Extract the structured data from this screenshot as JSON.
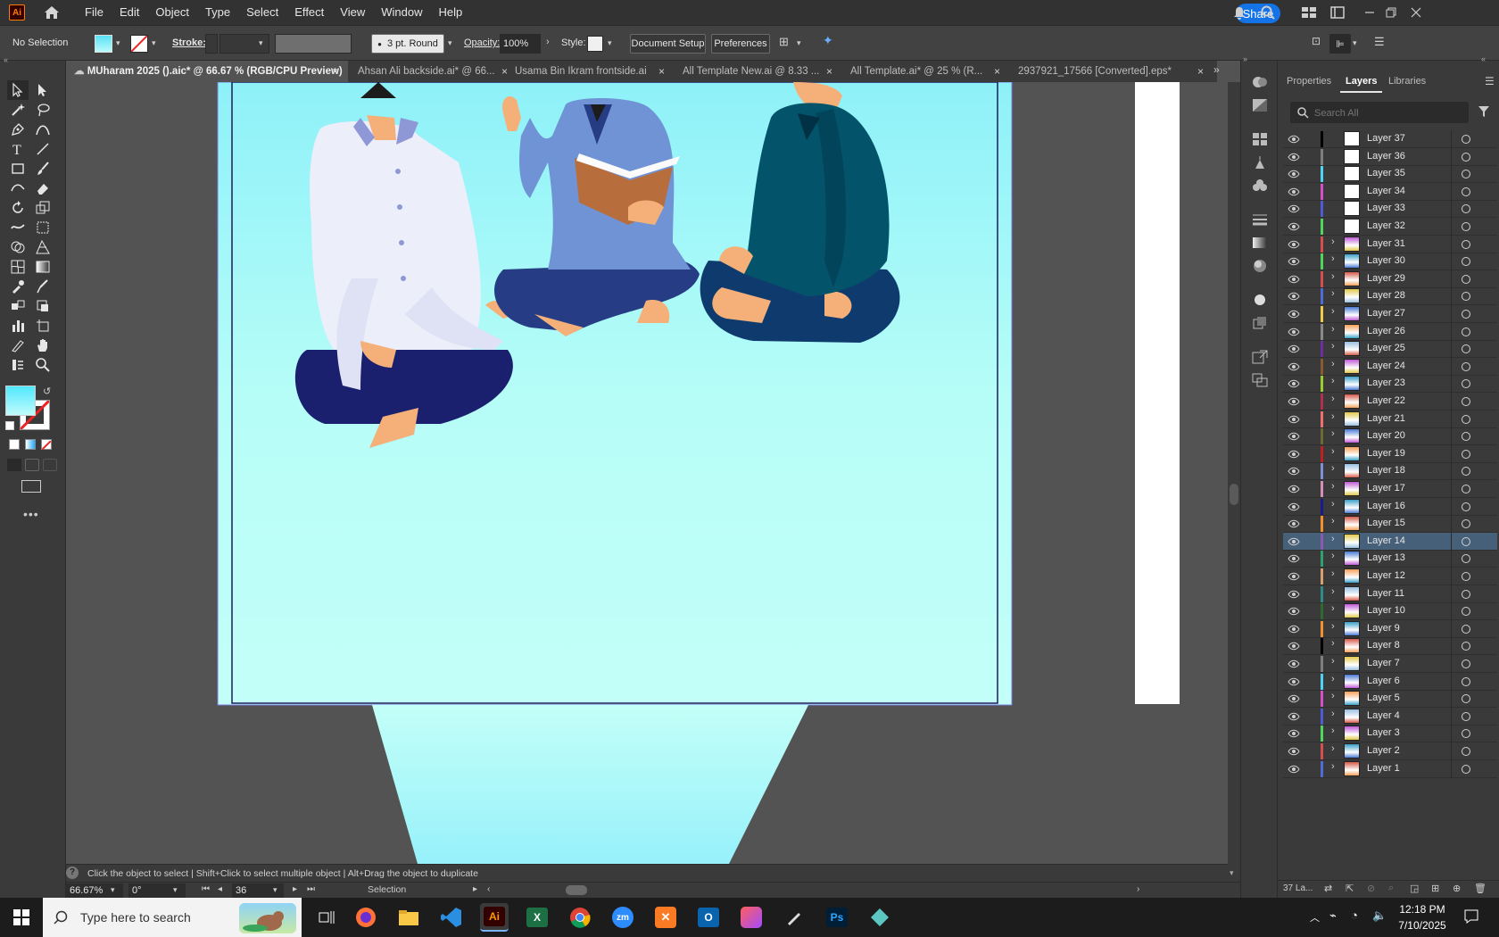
{
  "app": {
    "logo": "Ai",
    "menu": [
      "File",
      "Edit",
      "Object",
      "Type",
      "Select",
      "Effect",
      "View",
      "Window",
      "Help"
    ],
    "share_label": "Share"
  },
  "control": {
    "selection": "No Selection",
    "stroke_label": "Stroke:",
    "brush": "3 pt. Round",
    "opacity_label": "Opacity:",
    "opacity_value": "100%",
    "style_label": "Style:",
    "document_setup": "Document Setup",
    "preferences": "Preferences"
  },
  "tabs": [
    {
      "label": "MUharam 2025 ().aic* @ 66.67 % (RGB/CPU Preview)",
      "active": true
    },
    {
      "label": "Ahsan Ali backside.ai* @ 66...",
      "active": false
    },
    {
      "label": "Usama Bin Ikram frontside.ai",
      "active": false
    },
    {
      "label": "All Template New.ai @ 8.33 ...",
      "active": false
    },
    {
      "label": "All Template.ai* @ 25 % (R...",
      "active": false
    },
    {
      "label": "2937921_17566 [Converted].eps*",
      "active": false
    }
  ],
  "panel": {
    "tabs": [
      "Properties",
      "Layers",
      "Libraries"
    ],
    "search_placeholder": "Search All",
    "layers": [
      {
        "name": "Layer 37",
        "color": "#000000",
        "expand": false,
        "thumb": "white"
      },
      {
        "name": "Layer 36",
        "color": "#7f7f7f",
        "expand": false,
        "thumb": "white"
      },
      {
        "name": "Layer 35",
        "color": "#4fd3f5",
        "expand": false,
        "thumb": "white"
      },
      {
        "name": "Layer 34",
        "color": "#d64fc8",
        "expand": false,
        "thumb": "white"
      },
      {
        "name": "Layer 33",
        "color": "#4f5bd5",
        "expand": false,
        "thumb": "white"
      },
      {
        "name": "Layer 32",
        "color": "#4fd65b",
        "expand": false,
        "thumb": "white"
      },
      {
        "name": "Layer 31",
        "color": "#d64f4f",
        "expand": true,
        "thumb": "img"
      },
      {
        "name": "Layer 30",
        "color": "#4fd65b",
        "expand": true,
        "thumb": "img"
      },
      {
        "name": "Layer 29",
        "color": "#d64f4f",
        "expand": true,
        "thumb": "img"
      },
      {
        "name": "Layer 28",
        "color": "#4f6bd5",
        "expand": true,
        "thumb": "img"
      },
      {
        "name": "Layer 27",
        "color": "#f2c94f",
        "expand": true,
        "thumb": "img"
      },
      {
        "name": "Layer 26",
        "color": "#8a8a8a",
        "expand": true,
        "thumb": "img"
      },
      {
        "name": "Layer 25",
        "color": "#6b2fa0",
        "expand": true,
        "thumb": "img"
      },
      {
        "name": "Layer 24",
        "color": "#8a5a2f",
        "expand": true,
        "thumb": "img"
      },
      {
        "name": "Layer 23",
        "color": "#9acd32",
        "expand": true,
        "thumb": "img"
      },
      {
        "name": "Layer 22",
        "color": "#b03050",
        "expand": true,
        "thumb": "img"
      },
      {
        "name": "Layer 21",
        "color": "#f07070",
        "expand": true,
        "thumb": "img"
      },
      {
        "name": "Layer 20",
        "color": "#6b6b2f",
        "expand": true,
        "thumb": "img"
      },
      {
        "name": "Layer 19",
        "color": "#c02020",
        "expand": true,
        "thumb": "img"
      },
      {
        "name": "Layer 18",
        "color": "#7f8fd5",
        "expand": true,
        "thumb": "img"
      },
      {
        "name": "Layer 17",
        "color": "#d58fb5",
        "expand": true,
        "thumb": "img"
      },
      {
        "name": "Layer 16",
        "color": "#1a1a8a",
        "expand": true,
        "thumb": "img"
      },
      {
        "name": "Layer 15",
        "color": "#f28f2f",
        "expand": true,
        "thumb": "img"
      },
      {
        "name": "Layer 14",
        "color": "#8a5ab0",
        "expand": true,
        "thumb": "img",
        "selected": true
      },
      {
        "name": "Layer 13",
        "color": "#2fa06b",
        "expand": true,
        "thumb": "img"
      },
      {
        "name": "Layer 12",
        "color": "#d5a06b",
        "expand": true,
        "thumb": "img"
      },
      {
        "name": "Layer 11",
        "color": "#2f8a8a",
        "expand": true,
        "thumb": "img"
      },
      {
        "name": "Layer 10",
        "color": "#2f6b2f",
        "expand": true,
        "thumb": "img"
      },
      {
        "name": "Layer 9",
        "color": "#f28f2f",
        "expand": true,
        "thumb": "img"
      },
      {
        "name": "Layer 8",
        "color": "#000000",
        "expand": true,
        "thumb": "img"
      },
      {
        "name": "Layer 7",
        "color": "#7f7f7f",
        "expand": true,
        "thumb": "img"
      },
      {
        "name": "Layer 6",
        "color": "#4fd3f5",
        "expand": true,
        "thumb": "img"
      },
      {
        "name": "Layer 5",
        "color": "#d64fc8",
        "expand": true,
        "thumb": "img"
      },
      {
        "name": "Layer 4",
        "color": "#4f5bd5",
        "expand": true,
        "thumb": "img"
      },
      {
        "name": "Layer 3",
        "color": "#4fd65b",
        "expand": true,
        "thumb": "img"
      },
      {
        "name": "Layer 2",
        "color": "#d64f4f",
        "expand": true,
        "thumb": "img"
      },
      {
        "name": "Layer 1",
        "color": "#4f6bd5",
        "expand": true,
        "thumb": "img"
      }
    ],
    "layer_count": "37 La..."
  },
  "hint": {
    "text": "Click the object to select  |  Shift+Click to select multiple object  |  Alt+Drag the object to duplicate"
  },
  "status": {
    "zoom": "66.67%",
    "rotation": "0°",
    "artboard": "36",
    "tool": "Selection"
  },
  "taskbar": {
    "search_placeholder": "Type here to search",
    "time": "12:18 PM",
    "date": "7/10/2025"
  },
  "colors": {
    "canvas_top": "#8ef1f8",
    "canvas_bottom": "#c3fff8",
    "accent": "#1473e6",
    "selected_layer": "#46607a"
  }
}
